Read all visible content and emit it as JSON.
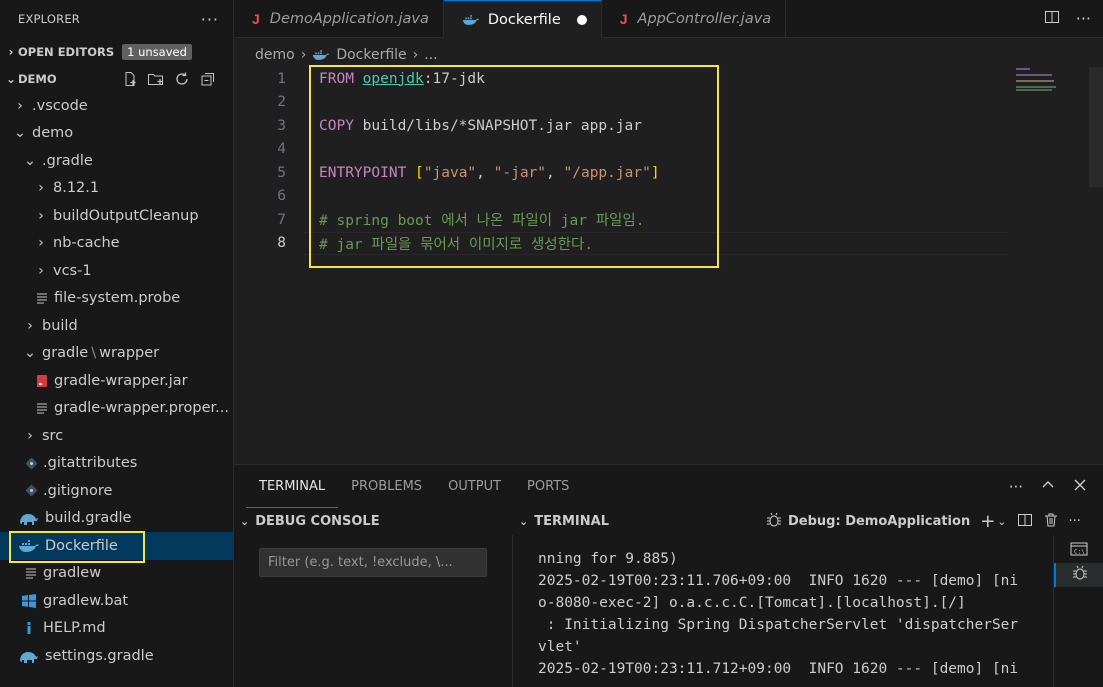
{
  "explorer": {
    "title": "EXPLORER",
    "more": "···",
    "open_editors": {
      "label": "OPEN EDITORS",
      "badge": "1 unsaved"
    },
    "project": {
      "label": "DEMO"
    },
    "tree": [
      {
        "label": ".vscode"
      },
      {
        "label": "demo"
      },
      {
        "label": ".gradle"
      },
      {
        "label": "8.12.1"
      },
      {
        "label": "buildOutputCleanup"
      },
      {
        "label": "nb-cache"
      },
      {
        "label": "vcs-1"
      },
      {
        "label": "file-system.probe"
      },
      {
        "label": "build"
      },
      {
        "label": "gradle",
        "label2": "wrapper"
      },
      {
        "label": "gradle-wrapper.jar"
      },
      {
        "label": "gradle-wrapper.proper..."
      },
      {
        "label": "src"
      },
      {
        "label": ".gitattributes"
      },
      {
        "label": ".gitignore"
      },
      {
        "label": "build.gradle"
      },
      {
        "label": "Dockerfile"
      },
      {
        "label": "gradlew"
      },
      {
        "label": "gradlew.bat"
      },
      {
        "label": "HELP.md"
      },
      {
        "label": "settings.gradle"
      }
    ]
  },
  "tabs": [
    {
      "label": "DemoApplication.java"
    },
    {
      "label": "Dockerfile"
    },
    {
      "label": "AppController.java"
    }
  ],
  "breadcrumb": {
    "folder": "demo",
    "file": "Dockerfile",
    "more": "..."
  },
  "code": {
    "line_numbers": [
      "1",
      "2",
      "3",
      "4",
      "5",
      "6",
      "7",
      "8"
    ],
    "l1_kw": "FROM",
    "l1_img": "openjdk",
    "l1_tag": ":17-jdk",
    "l3_kw": "COPY",
    "l3_rest": " build/libs/*SNAPSHOT.jar app.jar",
    "l5_kw": "ENTRYPOINT",
    "l5_open": "[",
    "l5_s1": "\"java\"",
    "l5_c1": ", ",
    "l5_s2": "\"-jar\"",
    "l5_c2": ", ",
    "l5_s3": "\"/app.jar\"",
    "l5_close": "]",
    "l7": "# spring boot 에서 나온 파일이 jar 파일임.",
    "l8": "# jar 파일을 묶어서 이미지로 생성한다."
  },
  "panel": {
    "tabs": [
      "TERMINAL",
      "PROBLEMS",
      "OUTPUT",
      "PORTS"
    ],
    "debug_console": "DEBUG CONSOLE",
    "terminal": "TERMINAL",
    "debug_session": "Debug: DemoApplication",
    "filter_placeholder": "Filter (e.g. text, !exclude, \\...",
    "output": [
      "nning for 9.885)",
      "2025-02-19T00:23:11.706+09:00  INFO 1620 --- [demo] [ni",
      "o-8080-exec-2] o.a.c.c.C.[Tomcat].[localhost].[/]",
      " : Initializing Spring DispatcherServlet 'dispatcherSer",
      "vlet'",
      "2025-02-19T00:23:11.712+09:00  INFO 1620 --- [demo] [ni"
    ]
  },
  "colors": {
    "accent": "#0078d4",
    "highlight": "#f5e642",
    "selection": "#04395e"
  }
}
